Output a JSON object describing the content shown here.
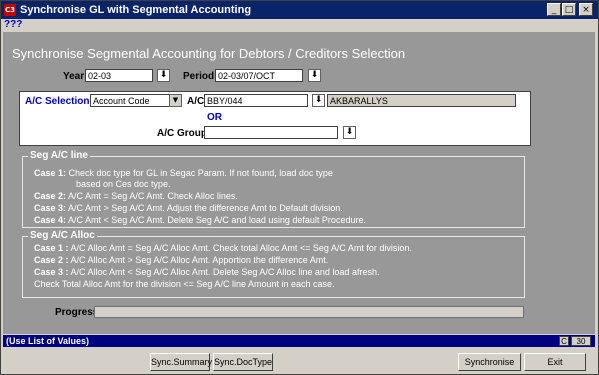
{
  "window": {
    "app_icon_text": "C3",
    "title": "Synchronise GL with Segmental Accounting",
    "minimize": "_",
    "maximize": "□",
    "close": "×"
  },
  "menu": {
    "label": "???"
  },
  "form": {
    "heading": "Synchronise Segmental Accounting for Debtors / Creditors  Selection",
    "year_label": "Year",
    "year_value": "02-03",
    "period_label": "Period",
    "period_value": "02-03/07/OCT",
    "ac_selection_label": "A/C Selection",
    "ac_selection_value": "Account Code",
    "ac_label": "A/C",
    "ac_value": "BBY/044",
    "ac_name_value": "AKBARALLYS",
    "or_label": "OR",
    "ac_group_label": "A/C Group",
    "ac_group_value": "",
    "lov_glyph": "⬇",
    "dropdown_glyph": "▼"
  },
  "seg_ac_line": {
    "title": "Seg A/C line",
    "lines": [
      {
        "case": "Case 1:",
        "text": " Check doc type for GL in Segac Param. If not found, load doc type"
      },
      {
        "case": "",
        "text": "based on Ces doc type."
      },
      {
        "case": "Case 2:",
        "text": " A/C Amt = Seg A/C Amt. Check Alloc lines."
      },
      {
        "case": "Case 3:",
        "text": " A/C Amt > Seg A/C Amt.  Adjust the difference Amt to Default division."
      },
      {
        "case": "Case 4:",
        "text": " A/C Amt < Seg A/C Amt.  Delete Seg A/C and load using default  Procedure."
      }
    ]
  },
  "seg_ac_alloc": {
    "title": "Seg A/C Alloc",
    "lines": [
      {
        "case": "Case 1 :",
        "text": " A/C Alloc Amt = Seg A/C Alloc Amt. Check total Alloc Amt <= Seg A/C Amt for division."
      },
      {
        "case": "Case 2 :",
        "text": " A/C Alloc Amt  > Seg A/C Alloc Amt.  Apportion the difference Amt."
      },
      {
        "case": "Case 3 :",
        "text": " A/C Alloc Amt < Seg A/C Alloc Amt.  Delete Seg A/C Alloc line and load afresh."
      },
      {
        "case": "",
        "text": "Check Total Alloc Amt for the division <= Seg A/C line Amount in each case."
      }
    ]
  },
  "progress": {
    "label": "Progress",
    "fraction": 0
  },
  "status": {
    "hint": "(Use List of Values)",
    "mode": "C",
    "number": "30"
  },
  "buttons": {
    "sync_summary": "Sync.Summary",
    "sync_doctype": "Sync.DocType",
    "synchronise": "Synchronise",
    "exit": "Exit"
  }
}
